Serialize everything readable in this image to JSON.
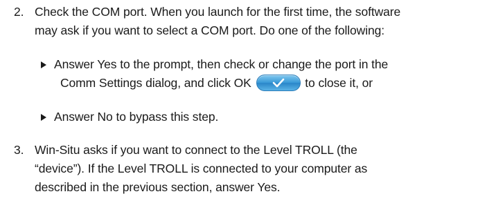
{
  "steps": [
    {
      "number": "2.",
      "lines": [
        "Check the COM port. When you launch for the first time, the software",
        "may ask if you want to select a COM port. Do one of the following:"
      ],
      "bullets": [
        {
          "line1": "Answer Yes to the prompt, then check or change the port in the",
          "line2_before": "Comm Settings dialog, and click OK",
          "line2_after": "to close it, or",
          "button_icon": "checkmark-icon"
        },
        {
          "line1": "Answer No to bypass this step."
        }
      ]
    },
    {
      "number": "3.",
      "lines": [
        "Win-Situ asks if you want to connect to the Level TROLL (the",
        "“device”). If the Level TROLL is connected to your computer as",
        "described in the previous section, answer Yes."
      ]
    }
  ]
}
